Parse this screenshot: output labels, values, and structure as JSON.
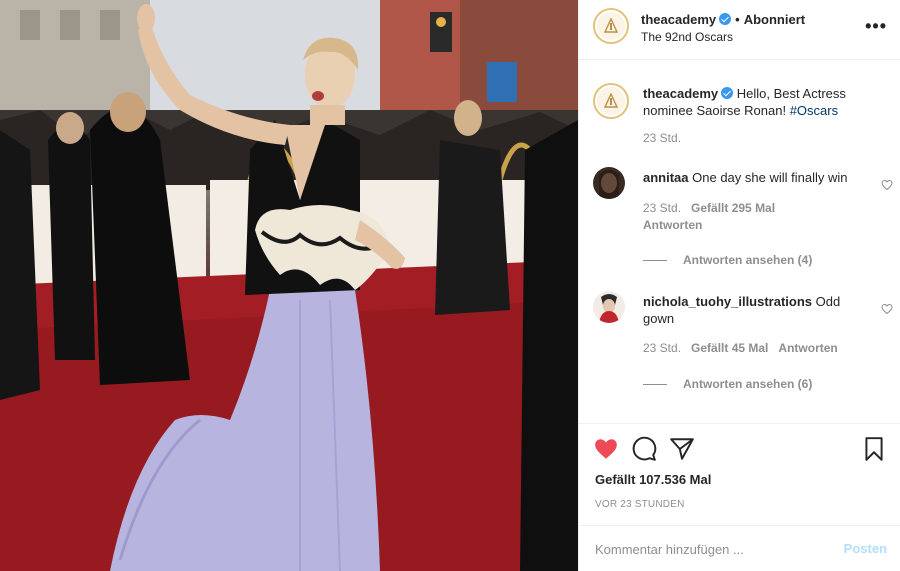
{
  "post": {
    "image_alt": "Saoirse Ronan on the red carpet",
    "author": "theacademy",
    "separator": "•",
    "follow_state": "Abonniert",
    "location": "The 92nd Oscars",
    "more_glyph": "•••"
  },
  "caption": {
    "author": "theacademy",
    "text": "Hello, Best Actress nominee Saoirse Ronan! ",
    "hashtag": "#Oscars",
    "time": "23 Std."
  },
  "comments": [
    {
      "author": "annitaa",
      "text": "One day she will finally win",
      "time": "23 Std.",
      "likes": "Gefällt 295 Mal",
      "reply": "Antworten",
      "view_replies": "Antworten ansehen (4)"
    },
    {
      "author": "nichola_tuohy_illustrations",
      "text": "Odd gown",
      "time": "23 Std.",
      "likes": "Gefällt 45 Mal",
      "reply": "Antworten",
      "view_replies": "Antworten ansehen (6)"
    }
  ],
  "actions": {
    "like_icon": "heart-icon",
    "comment_icon": "comment-icon",
    "share_icon": "share-icon",
    "save_icon": "bookmark-icon",
    "like_color": "#ed4956"
  },
  "likes": "Gefällt 107.536 Mal",
  "posted": "vor 23 Stunden",
  "add_comment": {
    "placeholder": "Kommentar hinzufügen ...",
    "post_label": "Posten"
  },
  "colors": {
    "verified": "#3897f0",
    "muted": "#8e8e8e",
    "post_disabled": "#b2dffc",
    "carpet": "#a31e24"
  }
}
